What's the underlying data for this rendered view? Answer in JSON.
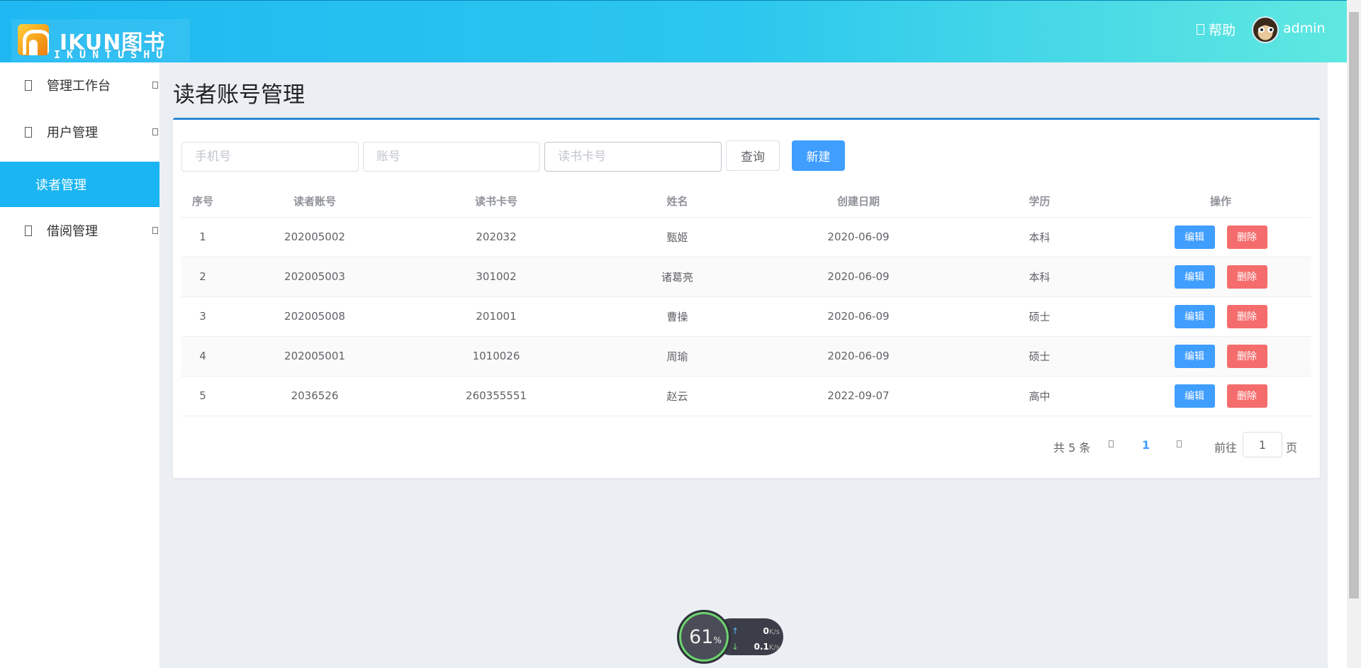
{
  "header": {
    "logo_text": "IKUN图书",
    "logo_sub": "IKUNTUSHU",
    "help_label": "帮助",
    "username": "admin"
  },
  "sidebar": {
    "items": [
      {
        "label": "管理工作台",
        "icon": "dashboard-icon"
      },
      {
        "label": "用户管理",
        "icon": "user-icon"
      },
      {
        "label": "读者管理",
        "icon": "",
        "active": true
      },
      {
        "label": "借阅管理",
        "icon": "borrow-icon"
      }
    ]
  },
  "page": {
    "title": "读者账号管理"
  },
  "search": {
    "phone_placeholder": "手机号",
    "account_placeholder": "账号",
    "card_placeholder": "读书卡号",
    "query_label": "查询",
    "create_label": "新建"
  },
  "table": {
    "headers": [
      "序号",
      "读者账号",
      "读书卡号",
      "姓名",
      "创建日期",
      "学历",
      "操作"
    ],
    "rows": [
      [
        "1",
        "202005002",
        "202032",
        "甄姬",
        "2020-06-09",
        "本科"
      ],
      [
        "2",
        "202005003",
        "301002",
        "诸葛亮",
        "2020-06-09",
        "本科"
      ],
      [
        "3",
        "202005008",
        "201001",
        "曹操",
        "2020-06-09",
        "硕士"
      ],
      [
        "4",
        "202005001",
        "1010026",
        "周瑜",
        "2020-06-09",
        "硕士"
      ],
      [
        "5",
        "2036526",
        "260355551",
        "赵云",
        "2022-09-07",
        "高中"
      ]
    ],
    "edit_label": "编辑",
    "delete_label": "删除"
  },
  "pagination": {
    "total_label": "共 5 条",
    "current_page": "1",
    "goto_label": "前往",
    "goto_value": "1",
    "page_unit": "页"
  },
  "net_widget": {
    "cpu_percent": "61",
    "percent_sign": "%",
    "up_value": "0",
    "up_unit": "K/s",
    "down_value": "0.1",
    "down_unit": "K/s"
  },
  "colors": {
    "header_start": "#1fb8f2",
    "header_end": "#5fe8e0",
    "sidebar_active": "#1ab5f2",
    "primary": "#409eff",
    "danger": "#f56c6c"
  }
}
